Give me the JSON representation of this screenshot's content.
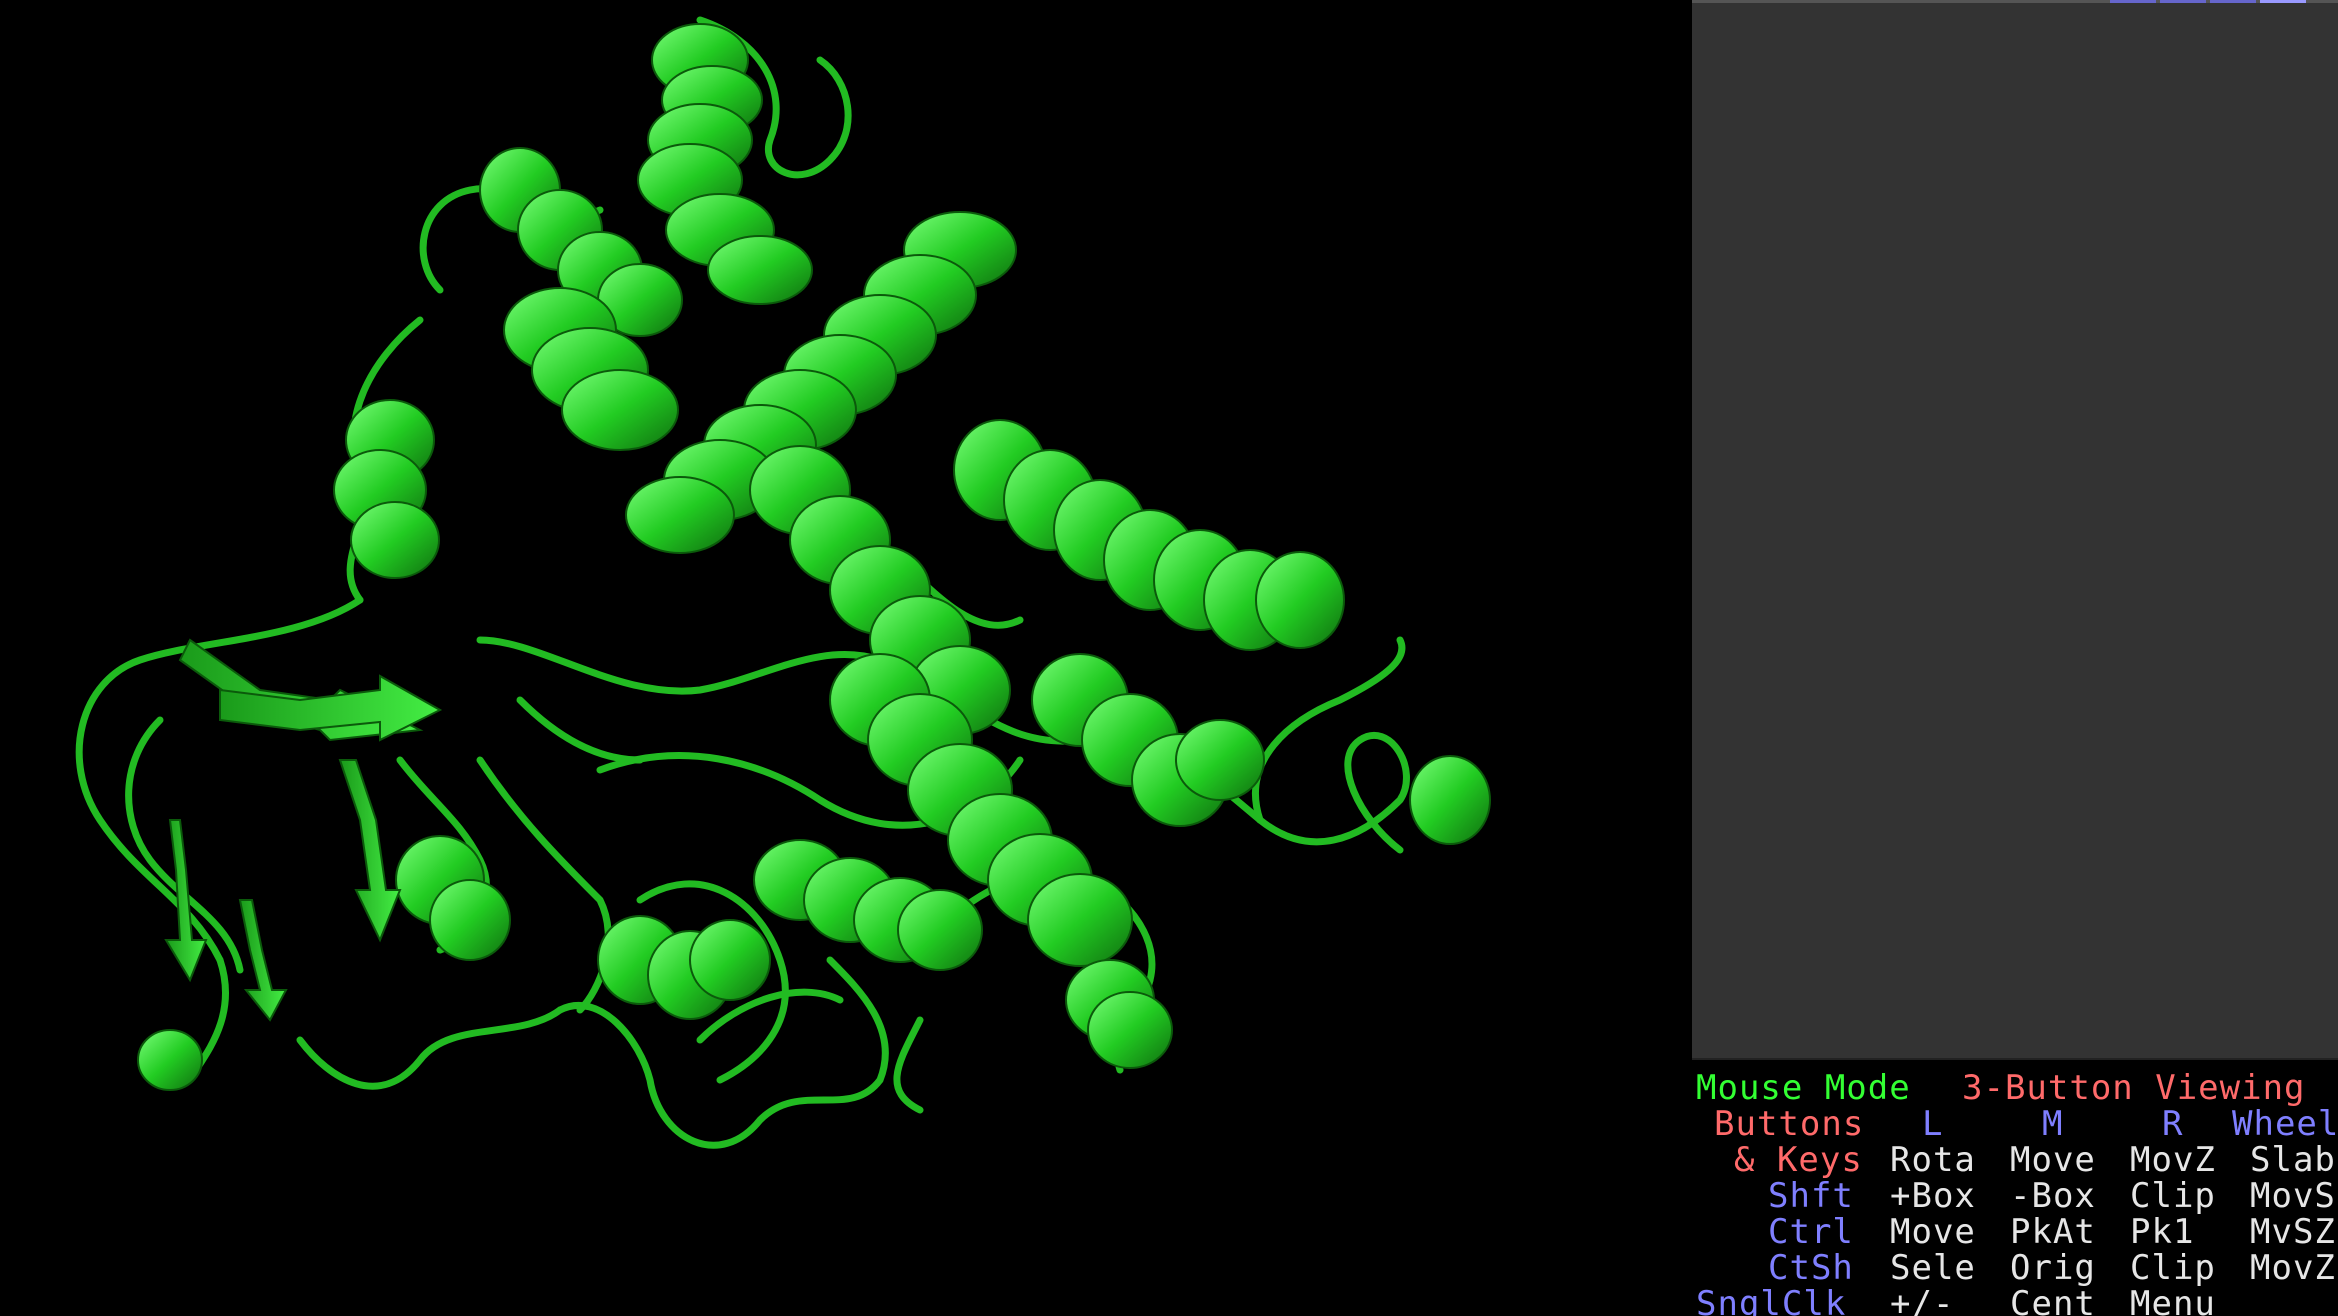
{
  "viewport": {
    "background": "#000000",
    "structure_color": "#22dd22",
    "representation": "cartoon"
  },
  "side_panel": {
    "background": "#333333",
    "top_strip_colors": [
      "#6666cc",
      "#6666cc",
      "#6666cc",
      "#9999ff"
    ]
  },
  "mouse_panel": {
    "title_label": "Mouse Mode",
    "mode_value": "3-Button Viewing",
    "header": {
      "buttons": "Buttons",
      "l": "L",
      "m": "M",
      "r": "R",
      "wheel": "Wheel"
    },
    "rows": [
      {
        "modifier": "& Keys",
        "l": "Rota",
        "m": "Move",
        "r": "MovZ",
        "wheel": "Slab"
      },
      {
        "modifier": "Shft",
        "l": "+Box",
        "m": "-Box",
        "r": "Clip",
        "wheel": "MovS"
      },
      {
        "modifier": "Ctrl",
        "l": "Move",
        "m": "PkAt",
        "r": "Pk1",
        "wheel": "MvSZ"
      },
      {
        "modifier": "CtSh",
        "l": "Sele",
        "m": "Orig",
        "r": "Clip",
        "wheel": "MovZ"
      },
      {
        "modifier": "SnglClk",
        "l": "+/-",
        "m": "Cent",
        "r": "Menu",
        "wheel": ""
      }
    ]
  }
}
